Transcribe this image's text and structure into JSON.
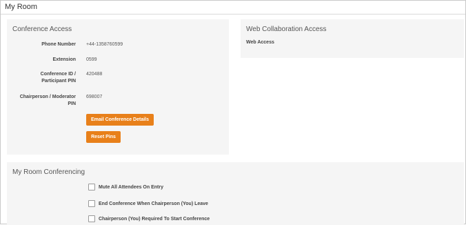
{
  "page": {
    "title": "My Room"
  },
  "conference_access": {
    "heading": "Conference Access",
    "fields": [
      {
        "label": "Phone Number",
        "value": "+44-1358760599"
      },
      {
        "label": "Extension",
        "value": "0599"
      },
      {
        "label": "Conference ID / Participant PIN",
        "label_line1": "Conference ID /",
        "label_line2": "Participant PIN",
        "value": "420488"
      },
      {
        "label": "Chairperson / Moderator PIN",
        "label_line1": "Chairperson / Moderator",
        "label_line2": "PIN",
        "value": "698007"
      }
    ],
    "email_button": "Email Conference Details",
    "reset_button": "Reset Pins"
  },
  "web_collaboration": {
    "heading": "Web Collaboration Access",
    "web_access_label": "Web Access"
  },
  "room_conferencing": {
    "heading": "My Room Conferencing",
    "options": [
      {
        "label": "Mute All Attendees On Entry",
        "checked": false
      },
      {
        "label": "End Conference When Chairperson (You) Leave",
        "checked": false
      },
      {
        "label": "Chairperson (You) Required To Start Conference",
        "checked": false
      }
    ]
  },
  "colors": {
    "accent": "#e8801a",
    "panel_bg": "#f5f5f5"
  }
}
